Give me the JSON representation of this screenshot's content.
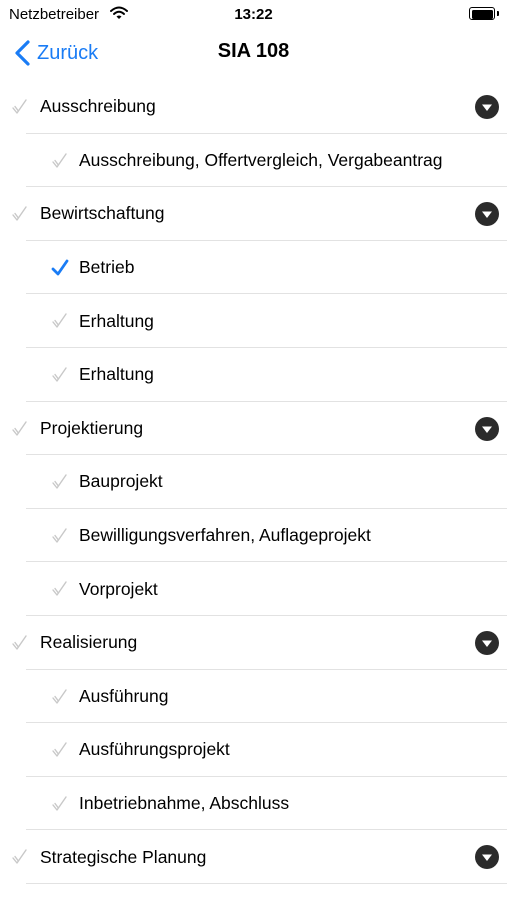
{
  "status_bar": {
    "carrier": "Netzbetreiber",
    "time": "13:22"
  },
  "nav": {
    "back_label": "Zurück",
    "title": "SIA 108"
  },
  "colors": {
    "accent": "#1a7cf5",
    "unchecked": "#c8c8c8",
    "disclosure": "#2b2b2b"
  },
  "rows": [
    {
      "type": "section",
      "label": "Ausschreibung",
      "checked": false
    },
    {
      "type": "item",
      "label": "Ausschreibung, Offertvergleich, Vergabeantrag",
      "checked": false
    },
    {
      "type": "section",
      "label": "Bewirtschaftung",
      "checked": false
    },
    {
      "type": "item",
      "label": "Betrieb",
      "checked": true
    },
    {
      "type": "item",
      "label": "Erhaltung",
      "checked": false
    },
    {
      "type": "item",
      "label": "Erhaltung",
      "checked": false
    },
    {
      "type": "section",
      "label": "Projektierung",
      "checked": false
    },
    {
      "type": "item",
      "label": "Bauprojekt",
      "checked": false
    },
    {
      "type": "item",
      "label": "Bewilligungsverfahren, Auflageprojekt",
      "checked": false
    },
    {
      "type": "item",
      "label": "Vorprojekt",
      "checked": false
    },
    {
      "type": "section",
      "label": "Realisierung",
      "checked": false
    },
    {
      "type": "item",
      "label": "Ausführung",
      "checked": false
    },
    {
      "type": "item",
      "label": "Ausführungsprojekt",
      "checked": false
    },
    {
      "type": "item",
      "label": "Inbetriebnahme, Abschluss",
      "checked": false
    },
    {
      "type": "section",
      "label": "Strategische Planung",
      "checked": false
    }
  ]
}
